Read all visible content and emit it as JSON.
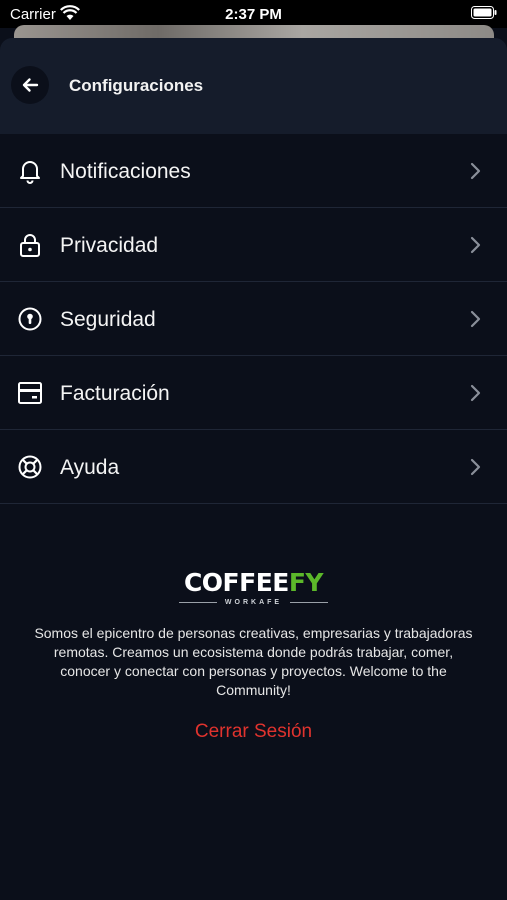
{
  "status_bar": {
    "carrier": "Carrier",
    "time": "2:37 PM"
  },
  "header": {
    "title": "Configuraciones",
    "back_icon": "arrow-left-icon"
  },
  "menu": {
    "items": [
      {
        "label": "Notificaciones",
        "icon": "bell-icon"
      },
      {
        "label": "Privacidad",
        "icon": "lock-icon"
      },
      {
        "label": "Seguridad",
        "icon": "keyhole-icon"
      },
      {
        "label": "Facturación",
        "icon": "card-icon"
      },
      {
        "label": "Ayuda",
        "icon": "lifebuoy-icon"
      }
    ]
  },
  "brand": {
    "logo_main": "COFFEE",
    "logo_accent": "FY",
    "logo_tagline": "WORKAFE",
    "about": "Somos el epicentro de personas creativas, empresarias y trabajadoras remotas. Creamos un ecosistema donde podrás trabajar, comer, conocer y conectar con personas y proyectos. Welcome to the Community!"
  },
  "logout_label": "Cerrar Sesión",
  "colors": {
    "background": "#0b0f1a",
    "header_background": "#151c2b",
    "accent_green": "#5cb82a",
    "logout_red": "#e0332e",
    "divider": "#1f2636"
  }
}
